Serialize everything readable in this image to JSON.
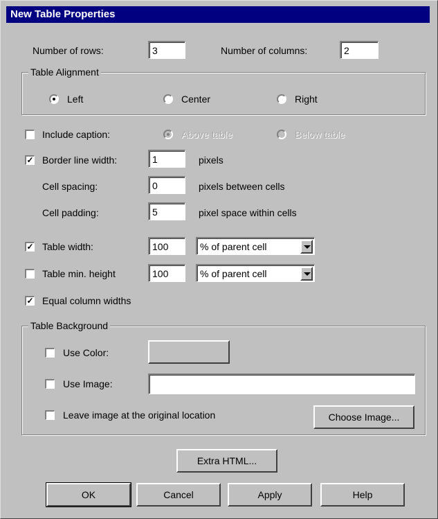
{
  "dialog": {
    "title": "New Table Properties"
  },
  "rows": {
    "label": "Number of rows:",
    "value": "3"
  },
  "columns": {
    "label": "Number of columns:",
    "value": "2"
  },
  "alignment": {
    "title": "Table Alignment",
    "options": [
      "Left",
      "Center",
      "Right"
    ],
    "selected": "Left"
  },
  "caption": {
    "label": "Include caption:",
    "checked": false,
    "above_label": "Above table",
    "below_label": "Below table"
  },
  "border": {
    "label": "Border line width:",
    "checked": true,
    "value": "1",
    "unit": "pixels"
  },
  "spacing": {
    "label": "Cell spacing:",
    "value": "0",
    "unit": "pixels between cells"
  },
  "padding": {
    "label": "Cell padding:",
    "value": "5",
    "unit": "pixel space within cells"
  },
  "width": {
    "label": "Table width:",
    "checked": true,
    "value": "100",
    "unit": "% of parent cell"
  },
  "min_height": {
    "label": "Table min. height",
    "checked": false,
    "value": "100",
    "unit": "% of parent cell"
  },
  "equal_widths": {
    "label": "Equal column widths",
    "checked": true
  },
  "background": {
    "title": "Table Background",
    "use_color_label": "Use Color:",
    "use_image_label": "Use Image:",
    "image_value": "",
    "leave_label": "Leave image at the original location",
    "choose_label": "Choose Image..."
  },
  "buttons": {
    "extra_html": "Extra HTML...",
    "ok": "OK",
    "cancel": "Cancel",
    "apply": "Apply",
    "help": "Help"
  }
}
